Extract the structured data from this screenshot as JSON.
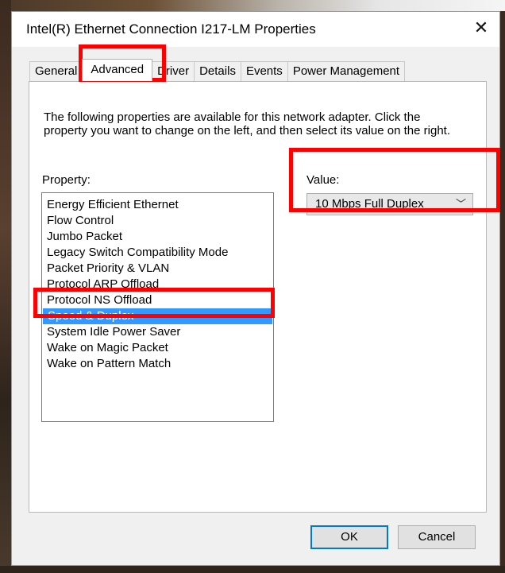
{
  "window": {
    "title": "Intel(R) Ethernet Connection I217-LM Properties",
    "close_symbol": "✕"
  },
  "tabs": [
    {
      "label": "General"
    },
    {
      "label": "Advanced"
    },
    {
      "label": "Driver"
    },
    {
      "label": "Details"
    },
    {
      "label": "Events"
    },
    {
      "label": "Power Management"
    }
  ],
  "active_tab": "Advanced",
  "description": "The following properties are available for this network adapter. Click the property you want to change on the left, and then select its value on the right.",
  "property_label": "Property:",
  "value_label": "Value:",
  "properties": [
    "Energy Efficient Ethernet",
    "Flow Control",
    "Jumbo Packet",
    "Legacy Switch Compatibility Mode",
    "Packet Priority & VLAN",
    "Protocol ARP Offload",
    "Protocol NS Offload",
    "Speed & Duplex",
    "System Idle Power Saver",
    "Wake on Magic Packet",
    "Wake on Pattern Match"
  ],
  "selected_property": "Speed & Duplex",
  "value_select": {
    "selected": "10 Mbps Full Duplex",
    "icon": "chevron-down-icon"
  },
  "buttons": {
    "ok": "OK",
    "cancel": "Cancel"
  },
  "colors": {
    "highlight": "#ff0000",
    "selection": "#3399ff",
    "default_button_border": "#0078d7"
  }
}
